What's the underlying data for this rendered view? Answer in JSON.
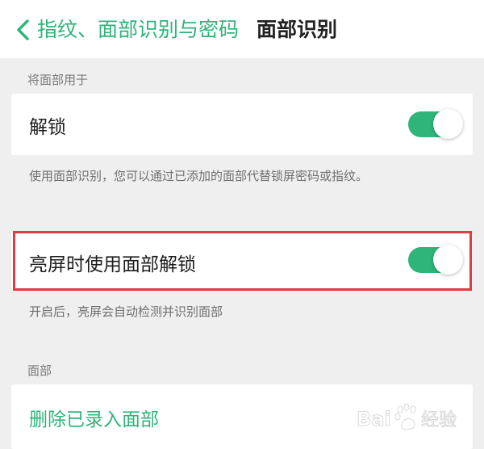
{
  "header": {
    "back_label": "指纹、面部识别与密码",
    "title": "面部识别"
  },
  "use_section": {
    "label": "将面部用于",
    "unlock": {
      "label": "解锁",
      "enabled": true
    },
    "unlock_hint": "使用面部识别，您可以通过已添加的面部代替锁屏密码或指纹。",
    "screen_on_unlock": {
      "label": "亮屏时使用面部解锁",
      "enabled": true
    },
    "screen_on_hint": "开启后，亮屏会自动检测并识别面部"
  },
  "face_section": {
    "label": "面部",
    "delete_label": "删除已录入面部"
  },
  "watermark": {
    "brand": "Baidu",
    "text": "经验"
  },
  "colors": {
    "accent": "#2fb47a",
    "highlight": "#e33b3f"
  }
}
